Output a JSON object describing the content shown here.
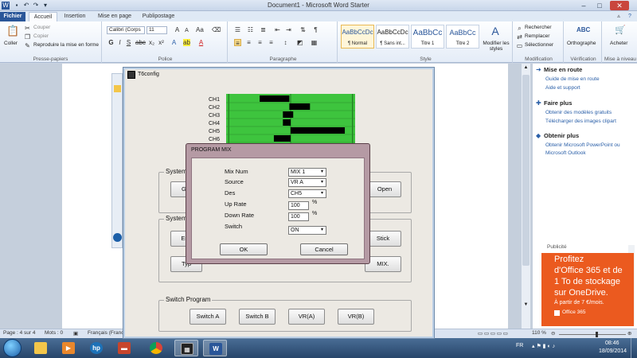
{
  "titlebar": {
    "title": "Document1  -  Microsoft Word Starter"
  },
  "ribbon_tabs": [
    "Fichier",
    "Accueil",
    "Insertion",
    "Mise en page",
    "Publipostage"
  ],
  "clipboard": {
    "paste": "Coller",
    "cut": "Couper",
    "copy": "Copier",
    "format_painter": "Reproduire la mise en forme",
    "label": "Presse-papiers"
  },
  "font": {
    "name": "Calibri (Corps",
    "size": "11",
    "label": "Police"
  },
  "paragraph": {
    "label": "Paragraphe"
  },
  "styles": {
    "items": [
      {
        "sample": "AaBbCcDc",
        "name": "¶ Normal"
      },
      {
        "sample": "AaBbCcDc",
        "name": "¶ Sans int..."
      },
      {
        "sample": "AaBbCc",
        "name": "Titre 1"
      },
      {
        "sample": "AaBbCc",
        "name": "Titre 2"
      }
    ],
    "modify": "Modifier les styles",
    "label": "Style"
  },
  "editing": {
    "find": "Rechercher",
    "replace": "Remplacer",
    "select": "Sélectionner",
    "label": "Modification"
  },
  "proofing": {
    "spelling": "Orthographe",
    "label": "Vérification"
  },
  "upgrade": {
    "buy": "Acheter",
    "label": "Mise à niveau"
  },
  "right_pane": {
    "s1_title": "Mise en route",
    "s1_links": [
      "Guide de mise en route",
      "Aide et support"
    ],
    "s2_title": "Faire plus",
    "s2_links": [
      "Obtenir des modèles gratuits",
      "Télécharger des images clipart"
    ],
    "s3_title": "Obtenir plus",
    "s3_links": [
      "Obtenir Microsoft PowerPoint ou",
      "Microsoft Outlook"
    ],
    "pub_label": "Publicité",
    "ad_lines": [
      "Profitez",
      "d'Office 365 et de",
      "1 To de stockage",
      "sur OneDrive."
    ],
    "ad_price": "À partir de 7 €/mois.",
    "ad_brand": "Office 365"
  },
  "statusbar": {
    "page": "Page : 4 sur 4",
    "words": "Mots : 0",
    "language": "Français (France)",
    "zoom": "110 %"
  },
  "taskbar": {
    "lang": "FR",
    "time": "08:46",
    "date": "18/09/2014"
  },
  "t6": {
    "title": "T6config",
    "channels": [
      "CH1",
      "CH2",
      "CH3",
      "CH4",
      "CH5",
      "CH6"
    ],
    "system_group": "System",
    "system_group2": "System S",
    "get_btn": "Get",
    "open_btn": "Open",
    "end_btn": "End",
    "type_btn": "Typ",
    "stick_btn": "Stick",
    "mix_btn": "MIX.",
    "switch_program": "Switch Program",
    "switch_buttons": [
      "Switch A",
      "Switch B",
      "VR(A)",
      "VR(B)"
    ]
  },
  "program_mix": {
    "title": "PROGRAM MIX",
    "mix_num_label": "Mix Num",
    "mix_num": "MIX 1",
    "source_label": "Source",
    "source": "VR A",
    "des_label": "Des",
    "des": "CH5",
    "up_rate_label": "Up Rate",
    "up_rate": "100",
    "down_rate_label": "Down Rate",
    "down_rate": "100",
    "switch_label": "Switch",
    "switch": "ON",
    "percent": "%",
    "ok": "OK",
    "cancel": "Cancel"
  },
  "chart_data": {
    "type": "bar",
    "categories": [
      "CH1",
      "CH2",
      "CH3",
      "CH4",
      "CH5",
      "CH6"
    ],
    "series": [
      {
        "ranges": [
          [
            0.26,
            0.49
          ],
          [
            0.49,
            0.65
          ],
          [
            0.44,
            0.52
          ],
          [
            0.44,
            0.5
          ],
          [
            0.5,
            0.92
          ],
          [
            0.37,
            0.5
          ]
        ]
      }
    ],
    "center": 0.5,
    "colors": {
      "track": "#3ec43e",
      "bar": "#000000"
    }
  }
}
